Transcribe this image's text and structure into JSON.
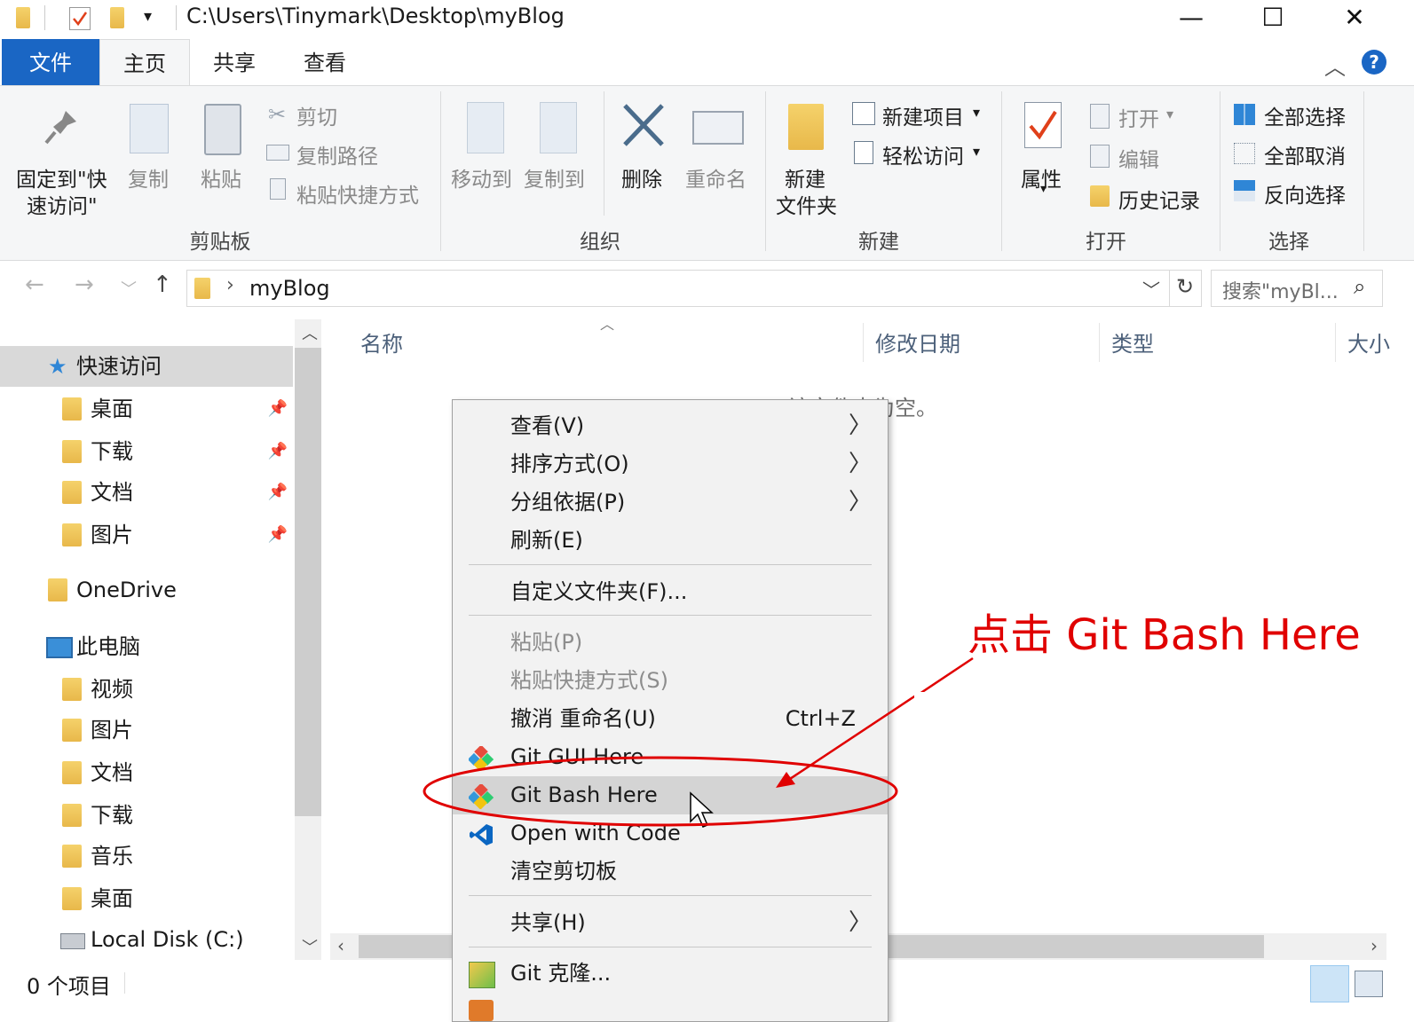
{
  "titlebar": {
    "path": "C:\\Users\\Tinymark\\Desktop\\myBlog",
    "qat_dropdown": "▾",
    "min": "—",
    "max": "☐",
    "close": "✕"
  },
  "tabs": {
    "file": "文件",
    "home": "主页",
    "share": "共享",
    "view": "查看"
  },
  "ribbon": {
    "clipboard": {
      "pin": "固定到\"快",
      "pin2": "速访问\"",
      "copy": "复制",
      "paste": "粘贴",
      "cut": "剪切",
      "copy_path": "复制路径",
      "paste_shortcut": "粘贴快捷方式",
      "group": "剪贴板"
    },
    "organize": {
      "move_to": "移动到",
      "copy_to": "复制到",
      "delete": "删除",
      "rename": "重命名",
      "group": "组织"
    },
    "new": {
      "new_folder1": "新建",
      "new_folder2": "文件夹",
      "new_item": "新建项目",
      "easy_access": "轻松访问",
      "group": "新建"
    },
    "open": {
      "properties": "属性",
      "open": "打开",
      "edit": "编辑",
      "history": "历史记录",
      "group": "打开"
    },
    "select": {
      "select_all": "全部选择",
      "select_none": "全部取消",
      "invert": "反向选择",
      "group": "选择"
    }
  },
  "address": {
    "crumb": "myBlog",
    "search_placeholder": "搜索\"myBl..."
  },
  "nav": {
    "quick_access": "快速访问",
    "qa_items": [
      "桌面",
      "下载",
      "文档",
      "图片"
    ],
    "onedrive": "OneDrive",
    "this_pc": "此电脑",
    "pc_items": [
      "视频",
      "图片",
      "文档",
      "下载",
      "音乐",
      "桌面"
    ],
    "local_disk": "Local Disk (C:)"
  },
  "columns": {
    "name": "名称",
    "date": "修改日期",
    "type": "类型",
    "size": "大小"
  },
  "empty_text": "该文件夹为空。",
  "status": {
    "count": "0 个项目"
  },
  "menu": {
    "view": "查看(V)",
    "sort": "排序方式(O)",
    "group": "分组依据(P)",
    "refresh": "刷新(E)",
    "customize": "自定义文件夹(F)...",
    "paste": "粘贴(P)",
    "paste_shortcut": "粘贴快捷方式(S)",
    "undo": "撤消 重命名(U)",
    "undo_shortcut": "Ctrl+Z",
    "git_gui": "Git GUI Here",
    "git_bash": "Git Bash Here",
    "open_code": "Open with Code",
    "clear_clipboard": "清空剪切板",
    "share": "共享(H)",
    "git_clone": "Git 克隆..."
  },
  "annotation": {
    "text": "点击 Git Bash Here",
    "color": "#e00000"
  },
  "colors": {
    "file_tab": "#1a66c4",
    "ribbon_bg": "#f5f6f7",
    "menu_bg": "#f2f2f2",
    "highlight": "#d4d4d4"
  }
}
